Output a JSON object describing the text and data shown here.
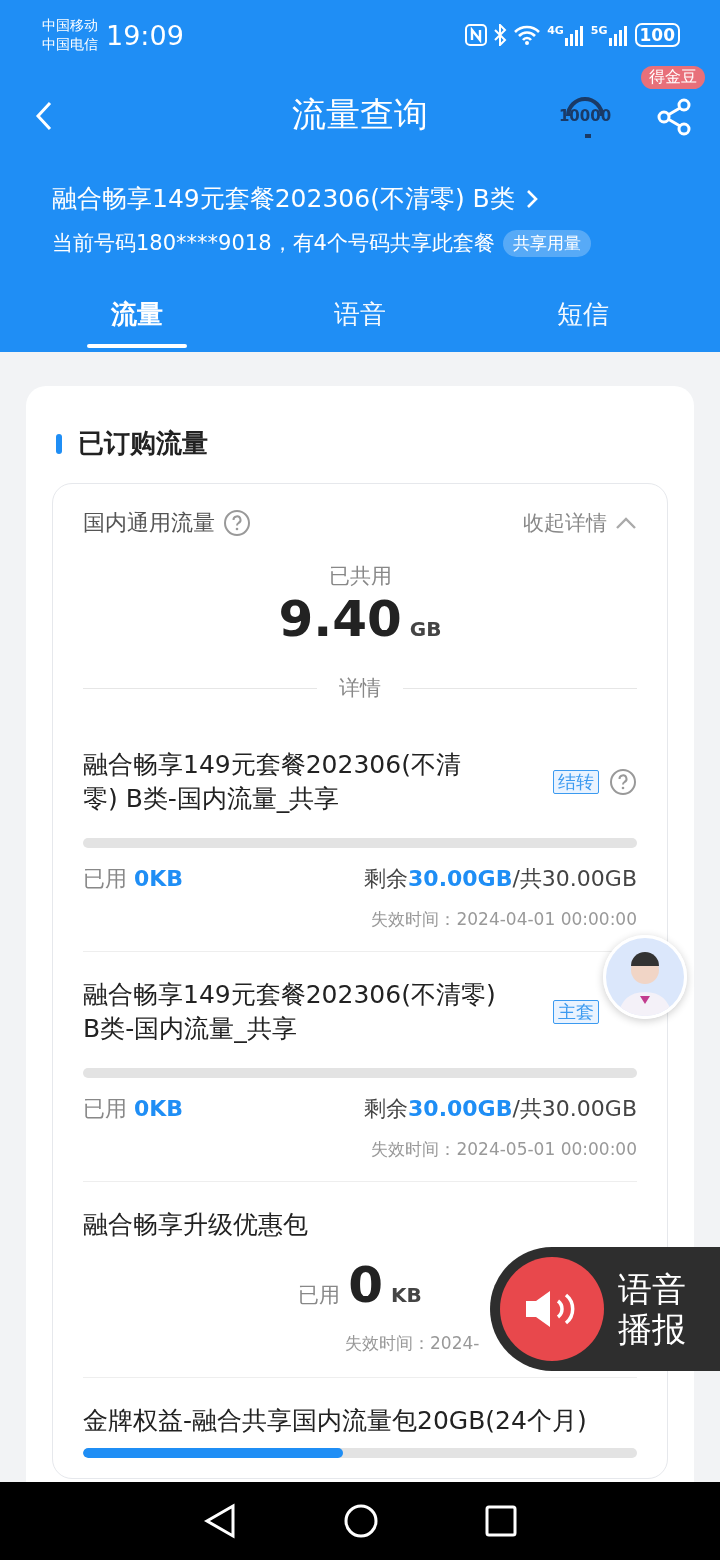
{
  "status_bar": {
    "carriers": [
      "中国移动",
      "中国电信"
    ],
    "time": "19:09",
    "signal_labels": [
      "4G",
      "5G"
    ],
    "battery": "100"
  },
  "header": {
    "title": "流量查询",
    "service_badge": "10000",
    "reward_badge": "得金豆",
    "plan_name": "融合畅享149元套餐202306(不清零) B类",
    "plan_info": "当前号码180****9018，有4个号码共享此套餐",
    "share_tag": "共享用量"
  },
  "tabs": [
    {
      "label": "流量",
      "selected": true
    },
    {
      "label": "语音",
      "selected": false
    },
    {
      "label": "短信",
      "selected": false
    }
  ],
  "section_title": "已订购流量",
  "usage_box": {
    "title": "国内通用流量",
    "toggle": "收起详情",
    "expanded": true,
    "used_label": "已共用",
    "used_value": "9.40",
    "used_unit": "GB",
    "details_label": "详情",
    "items": [
      {
        "kind": "bar",
        "title": "融合畅享149元套餐202306(不清零) B类-国内流量_共享",
        "tag": "结转",
        "help": true,
        "level": 0,
        "used_label": "已用",
        "used": "0KB",
        "remaining_label": "剩余",
        "remaining": "30.00GB",
        "total": "/共30.00GB",
        "expiry": "失效时间：2024-04-01 00:00:00"
      },
      {
        "kind": "bar",
        "title": "融合畅享149元套餐202306(不清零) B类-国内流量_共享",
        "tag": "主套",
        "help": false,
        "level": 0,
        "used_label": "已用",
        "used": "0KB",
        "remaining_label": "剩余",
        "remaining": "30.00GB",
        "total": "/共30.00GB",
        "expiry": "失效时间：2024-05-01 00:00:00"
      },
      {
        "kind": "simple",
        "title": "融合畅享升级优惠包",
        "used_label": "已用",
        "used": "0",
        "unit": "KB",
        "expiry": "失效时间：2024-"
      },
      {
        "kind": "bar_partial",
        "title": "金牌权益-融合共享国内流量包20GB(24个月)",
        "level": 0.47
      }
    ]
  },
  "voice_button": {
    "label": "语音播报"
  }
}
